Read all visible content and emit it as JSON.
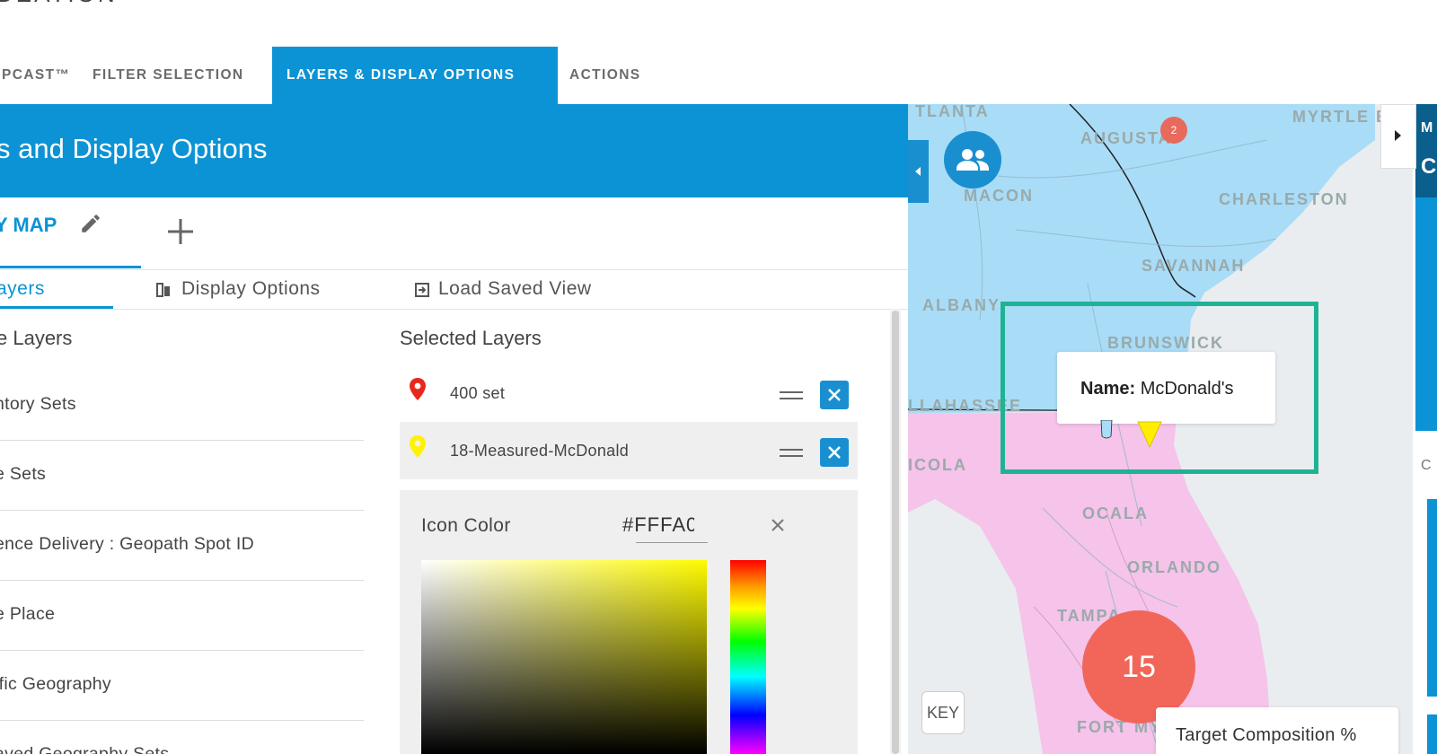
{
  "brand": {
    "text": "DEATION"
  },
  "nav": {
    "tabs": [
      {
        "label": "PCAST™"
      },
      {
        "label": "FILTER SELECTION"
      },
      {
        "label": "LAYERS & DISPLAY OPTIONS",
        "active": true
      },
      {
        "label": "ACTIONS"
      }
    ]
  },
  "panel": {
    "title": "s and Display Options",
    "view_tab": "Y MAP",
    "sub_tabs": [
      {
        "label": "ayers",
        "active": true
      },
      {
        "label": "Display Options"
      },
      {
        "label": "Load Saved View"
      }
    ],
    "available": {
      "title": "e Layers",
      "items": [
        "ntory Sets",
        "e Sets",
        "ence Delivery : Geopath Spot ID",
        "e Place",
        "ific Geography",
        "aved Geography Sets"
      ]
    },
    "selected": {
      "title": "Selected Layers",
      "items": [
        {
          "label": "400 set",
          "pin_color": "#e8281c"
        },
        {
          "label": "18-Measured-McDonald",
          "pin_color": "#fff200"
        }
      ]
    },
    "icon_color": {
      "label": "Icon Color",
      "value": "#FFFA0"
    }
  },
  "map": {
    "labels": {
      "atlanta": "TLANTA",
      "augusta": "AUGUSTA",
      "myrtle": "MYRTLE B",
      "macon": "MACON",
      "charleston": "CHARLESTON",
      "savannah": "SAVANNAH",
      "albany": "ALBANY",
      "brunswick": "BRUNSWICK",
      "tallahassee": "LLAHASSEE",
      "pensacola": "ICOLA",
      "ocala": "OCALA",
      "orlando": "ORLANDO",
      "tampa": "TAMPA",
      "fortmyers": "FORT MY"
    },
    "small_cluster_count": "2",
    "big_cluster_count": "15",
    "tooltip": {
      "key": "Name:",
      "value": "McDonald's"
    },
    "key_button": "KEY",
    "legend": "Target Composition %",
    "colors": {
      "georgia": "#a9dcf7",
      "florida": "#f6c3ea",
      "highlight": "#1fb394",
      "cluster": "#f26659"
    }
  },
  "right_strip": {
    "letter1": "M",
    "letter2": "C",
    "letter3": "C"
  }
}
